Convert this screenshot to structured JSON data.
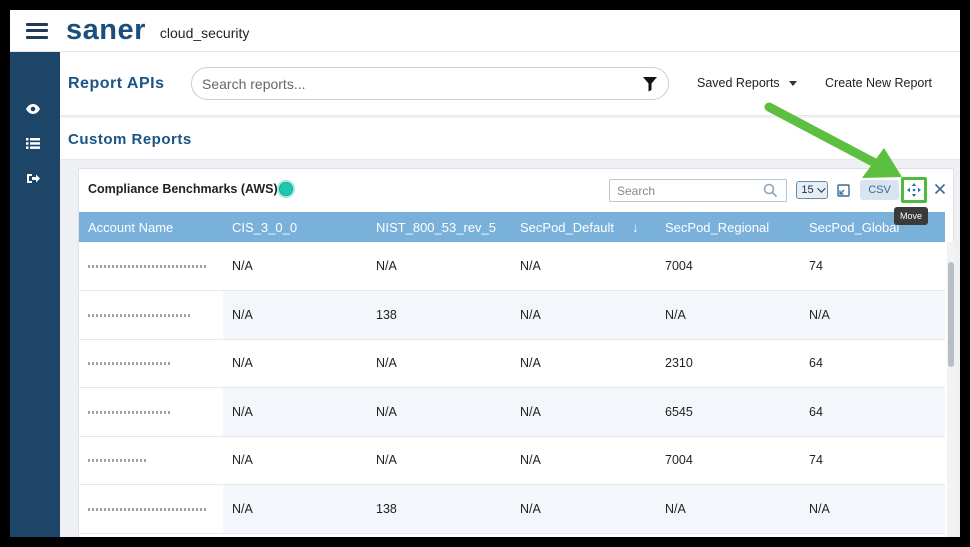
{
  "app": {
    "logo": "saner",
    "org": "cloud_security"
  },
  "sidebar": {
    "items": [
      {
        "icon": "eye-icon"
      },
      {
        "icon": "list-icon"
      },
      {
        "icon": "sign-out-icon"
      }
    ]
  },
  "header": {
    "title": "Report APIs",
    "search_placeholder": "Search reports...",
    "saved_reports": "Saved Reports",
    "create_report": "Create New Report"
  },
  "section": {
    "title": "Custom Reports"
  },
  "report": {
    "title": "Compliance Benchmarks (AWS)",
    "search_placeholder": "Search",
    "page_size": "15",
    "csv_label": "CSV",
    "move_tooltip": "Move",
    "columns": [
      "Account Name",
      "CIS_3_0_0",
      "NIST_800_53_rev_5",
      "SecPod_Default",
      "SecPod_Regional",
      "SecPod_Global"
    ],
    "rows": [
      [
        "N/A",
        "N/A",
        "N/A",
        "7004",
        "74"
      ],
      [
        "N/A",
        "138",
        "N/A",
        "N/A",
        "N/A"
      ],
      [
        "N/A",
        "N/A",
        "N/A",
        "2310",
        "64"
      ],
      [
        "N/A",
        "N/A",
        "N/A",
        "6545",
        "64"
      ],
      [
        "N/A",
        "N/A",
        "N/A",
        "7004",
        "74"
      ],
      [
        "N/A",
        "138",
        "N/A",
        "N/A",
        "N/A"
      ]
    ]
  },
  "colors": {
    "brand": "#1b4e7a",
    "sidebar": "#1c4568",
    "table_header": "#79b1da",
    "highlight": "#4cbc3b"
  }
}
